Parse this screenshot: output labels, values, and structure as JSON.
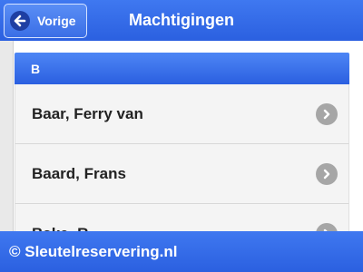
{
  "header": {
    "title": "Machtigingen",
    "back_label": "Vorige"
  },
  "list": {
    "section_letter": "B",
    "items": [
      {
        "label": "Baar, Ferry van"
      },
      {
        "label": "Baard, Frans"
      },
      {
        "label": "Bake, R..."
      }
    ]
  },
  "footer": {
    "text": "© Sleutelreservering.nl"
  },
  "colors": {
    "accent_blue": "#2b60e0",
    "item_bg": "#f4f4f4",
    "chevron_gray": "#a6a6a6"
  }
}
